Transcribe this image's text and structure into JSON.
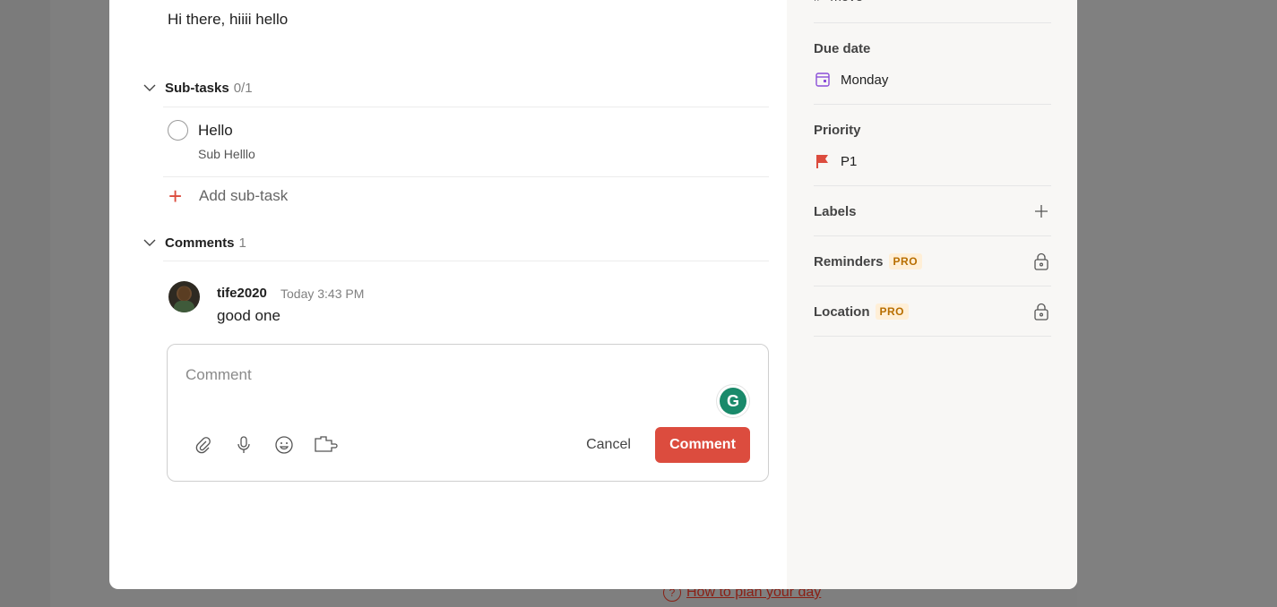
{
  "task": {
    "description": "Hi there, hiiii hello"
  },
  "subtasks": {
    "heading": "Sub-tasks",
    "count": "0/1",
    "items": [
      {
        "title": "Hello",
        "description": "Sub Helllo"
      }
    ],
    "add_label": "Add sub-task"
  },
  "comments": {
    "heading": "Comments",
    "count": "1",
    "items": [
      {
        "author": "tife2020",
        "time": "Today 3:43 PM",
        "text": "good one"
      }
    ],
    "input_placeholder": "Comment",
    "cancel_label": "Cancel",
    "submit_label": "Comment"
  },
  "sidebar": {
    "project_value": "move",
    "due_date": {
      "label": "Due date",
      "value": "Monday",
      "icon": "calendar-icon"
    },
    "priority": {
      "label": "Priority",
      "value": "P1",
      "icon": "flag-icon",
      "color": "#dc4c3e"
    },
    "labels": {
      "label": "Labels",
      "icon": "plus-icon"
    },
    "reminders": {
      "label": "Reminders",
      "badge": "PRO",
      "icon": "lock-icon"
    },
    "location": {
      "label": "Location",
      "badge": "PRO",
      "icon": "lock-icon"
    }
  },
  "footer": {
    "help_link": "How to plan your day"
  },
  "colors": {
    "accent": "#dc4c3e",
    "backdrop": "#7f7f7f",
    "sidebar_bg": "#f8f7f5",
    "pro_badge_bg": "#ffefd7",
    "pro_badge_text": "#b86e00"
  }
}
